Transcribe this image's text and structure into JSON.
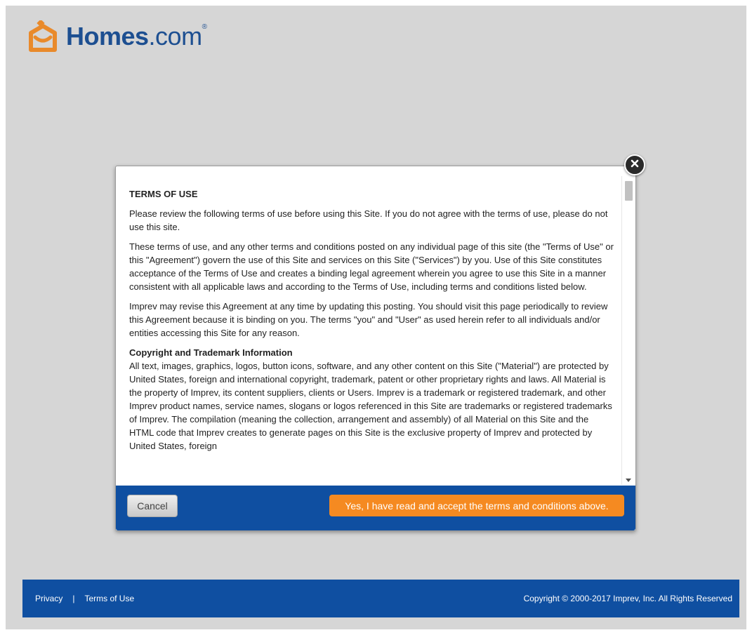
{
  "brand": {
    "name_bold": "Homes",
    "name_light": ".com",
    "registered": "®",
    "icon": "homes-logo-icon",
    "colors": {
      "primary": "#1d4f91",
      "accent": "#e98a2b"
    }
  },
  "modal": {
    "close_icon": "close-icon",
    "title": "TERMS OF USE",
    "paragraphs": [
      "Please review the following terms of use before using this Site. If you do not agree with the terms of use, please do not use this site.",
      "These terms of use, and any other terms and conditions posted on any individual page of this site (the \"Terms of Use\" or this \"Agreement\") govern the use of this Site and services on this Site (\"Services\") by you. Use of this Site constitutes acceptance of the Terms of Use and creates a binding legal agreement wherein you agree to use this Site in a manner consistent with all applicable laws and according to the Terms of Use, including terms and conditions listed below.",
      "Imprev may revise this Agreement at any time by updating this posting. You should visit this page periodically to review this Agreement because it is binding on you. The terms \"you\" and \"User\" as used herein refer to all individuals and/or entities accessing this Site for any reason."
    ],
    "section_heading": "Copyright and Trademark Information",
    "section_text": "All text, images, graphics, logos, button icons, software, and any other content on this Site (\"Material\") are protected by United States, foreign and international copyright, trademark, patent or other proprietary rights and laws. All Material is the property of Imprev, its content suppliers, clients or Users. Imprev is a trademark or registered trademark, and other Imprev product names, service names, slogans or logos referenced in this Site are trademarks or registered trademarks of Imprev. The compilation (meaning the collection, arrangement and assembly) of all Material on this Site and the HTML code that Imprev creates to generate pages on this Site is the exclusive property of Imprev and protected by United States, foreign",
    "cancel_label": "Cancel",
    "accept_label": "Yes, I have read and accept the terms and conditions above.",
    "colors": {
      "footer_bar": "#0f4fa1",
      "accept_button": "#f58a21"
    }
  },
  "footer": {
    "privacy_label": "Privacy",
    "separator": "|",
    "terms_label": "Terms of Use",
    "copyright": "Copyright © 2000-2017 Imprev, Inc. All Rights Reserved"
  }
}
